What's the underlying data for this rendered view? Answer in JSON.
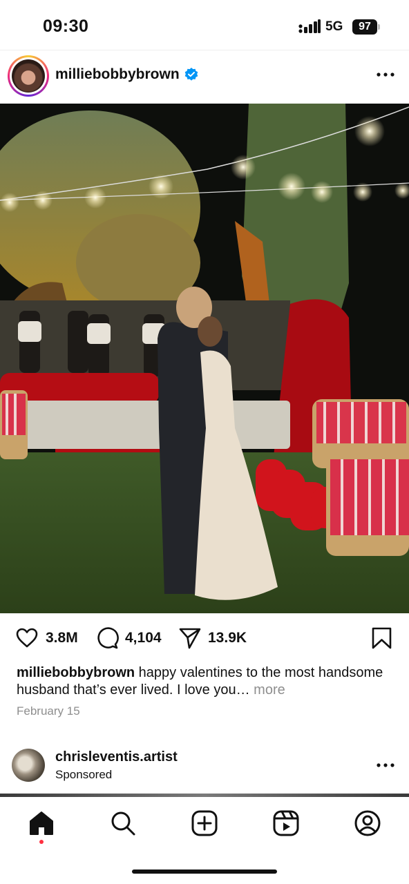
{
  "status_bar": {
    "time": "09:30",
    "network": "5G",
    "battery": "97"
  },
  "post": {
    "username": "milliebobbybrown",
    "verified": true,
    "image_alt": "couple dancing",
    "likes": "3.8M",
    "comments": "4,104",
    "shares": "13.9K",
    "caption_user": "milliebobbybrown",
    "caption_text": " happy valentines to the most handsome husband that’s ever lived. I love you…",
    "caption_more": " more",
    "date": "February 15"
  },
  "sponsored": {
    "username": "chrisleventis.artist",
    "label": "Sponsored"
  },
  "nav": {
    "items": [
      {
        "icon": "home-icon",
        "active": true
      },
      {
        "icon": "search-icon"
      },
      {
        "icon": "create-icon"
      },
      {
        "icon": "reels-icon"
      },
      {
        "icon": "profile-icon"
      }
    ]
  },
  "colors": {
    "verified": "#0095f6",
    "notification": "#ff3040",
    "muted": "#8e8e8e"
  }
}
